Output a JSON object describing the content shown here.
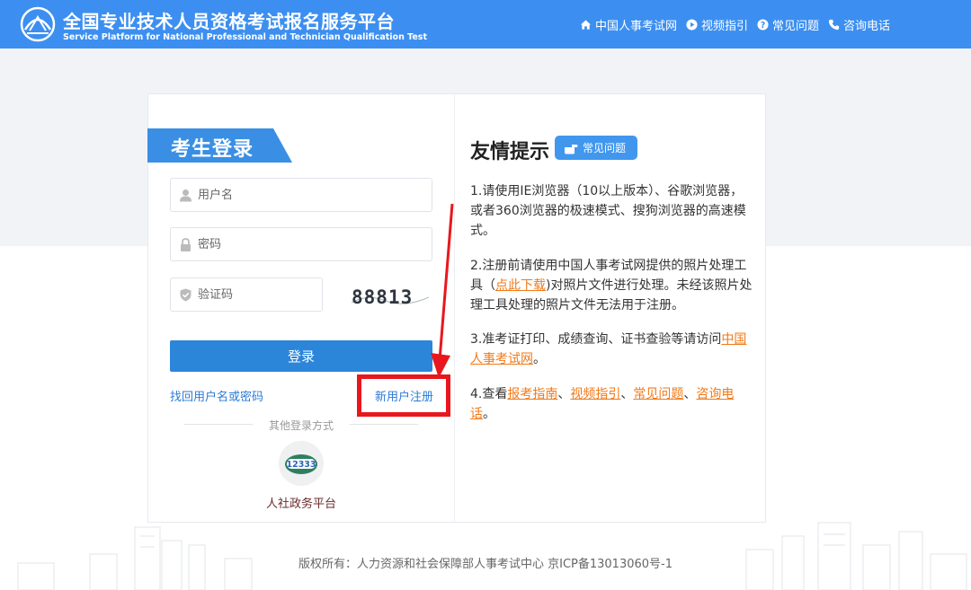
{
  "header": {
    "title_zh": "全国专业技术人员资格考试报名服务平台",
    "title_en": "Service Platform for National Professional and Technician Qualification Test",
    "nav": [
      {
        "label": "中国人事考试网",
        "icon": "home-icon"
      },
      {
        "label": "视频指引",
        "icon": "play-icon"
      },
      {
        "label": "常见问题",
        "icon": "question-icon"
      },
      {
        "label": "咨询电话",
        "icon": "phone-icon"
      }
    ]
  },
  "login": {
    "tab_title": "考生登录",
    "username_placeholder": "用户名",
    "password_placeholder": "密码",
    "captcha_placeholder": "验证码",
    "captcha_text": "88813",
    "login_button": "登录",
    "recover_link": "找回用户名或密码",
    "register_link": "新用户注册",
    "other_methods": "其他登录方式",
    "gov_platform": "人社政务平台",
    "gov_icon_text": "12333"
  },
  "tips": {
    "title": "友情提示",
    "faq_badge": "常见问题",
    "t1": "1.请使用IE浏览器（10以上版本）、谷歌浏览器，或者360浏览器的极速模式、搜狗浏览器的高速模式。",
    "t2_before": "2.注册前请使用中国人事考试网提供的照片处理工具（",
    "t2_link": "点此下载",
    "t2_after": ")对照片文件进行处理。未经该照片处理工具处理的照片文件无法用于注册。",
    "t3_before": "3.准考证打印、成绩查询、证书查验等请访问",
    "t3_link": "中国人事考试网",
    "t3_after": "。",
    "t4_before": "4.查看",
    "t4_link1": "报考指南",
    "t4_sep1": "、",
    "t4_link2": "视频指引",
    "t4_sep2": "、",
    "t4_link3": "常见问题",
    "t4_sep3": "、",
    "t4_link4": "咨询电话",
    "t4_after": "。"
  },
  "footer": "版权所有：人力资源和社会保障部人事考试中心 京ICP备13013060号-1",
  "colors": {
    "header_bg": "#3c8ff0",
    "button_bg": "#2b86d9",
    "link": "#2b7bd6",
    "accent_orange": "#f07a1a",
    "highlight_red": "#e8171d"
  }
}
